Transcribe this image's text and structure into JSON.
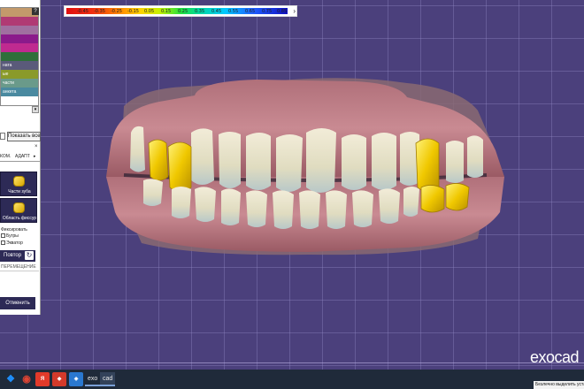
{
  "color_scale": {
    "ticks": [
      "-0.45",
      "-0.35",
      "-0.25",
      "-0.15",
      "0.05",
      "0.15",
      "0.25",
      "0.35",
      "0.45",
      "0.55",
      "0.65",
      "0.75",
      "0.85"
    ],
    "arrow": "›"
  },
  "left_panel": {
    "help": "?",
    "list_rows": [
      {
        "label": "",
        "color": "#c39a6b"
      },
      {
        "label": "",
        "color": "#b03a74"
      },
      {
        "label": "",
        "color": "#a06fa0"
      },
      {
        "label": "",
        "color": "#8b1a8b"
      },
      {
        "label": "",
        "color": "#c02a90"
      },
      {
        "label": "",
        "color": "#2f6f3a"
      },
      {
        "label": "ната",
        "color": "#5a5a7a"
      },
      {
        "label": "ые",
        "color": "#8a9a2a"
      },
      {
        "label": "части",
        "color": "#6a9a8a"
      },
      {
        "label": "анкета",
        "color": "#4a8aa0"
      }
    ],
    "scroll_arrow": "▾",
    "show_all_label": "Показать все",
    "close": "×",
    "tabs": [
      "КОМ.",
      "АДАПТ",
      "▸"
    ],
    "tool_parts_label": "Части зуба",
    "tool_fissure_label": "Область фиссур",
    "fix_label": "Фиксировать",
    "check_bugry": "Бугры",
    "check_ekvator": "Экватор",
    "repeat_label": "Повтор",
    "repeat_icon": "↻",
    "move_label": "ПЕРЕМЕЩЕНИЕ",
    "cancel_label": "Отменить"
  },
  "logo": "exocad",
  "taskbar": {
    "items": [
      {
        "name": "windows-start-icon",
        "glyph": "❖",
        "color": "#1e90ff"
      },
      {
        "name": "chrome-icon",
        "glyph": "◉",
        "color": "#dd4433"
      },
      {
        "name": "yandex-icon",
        "glyph": "Я",
        "color": "#e23a2a"
      },
      {
        "name": "anydesk-icon",
        "glyph": "◆",
        "color": "#d33a2a"
      },
      {
        "name": "app-icon",
        "glyph": "◈",
        "color": "#2a78d0"
      }
    ],
    "text_items": [
      "exo",
      "cad"
    ],
    "tray_tooltip": "Безлечно выделить уста"
  }
}
